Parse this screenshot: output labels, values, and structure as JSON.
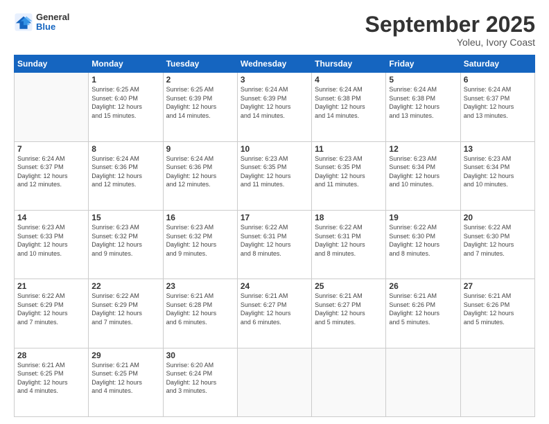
{
  "header": {
    "logo_general": "General",
    "logo_blue": "Blue",
    "month_title": "September 2025",
    "location": "Yoleu, Ivory Coast"
  },
  "days_of_week": [
    "Sunday",
    "Monday",
    "Tuesday",
    "Wednesday",
    "Thursday",
    "Friday",
    "Saturday"
  ],
  "weeks": [
    [
      {
        "day": "",
        "info": ""
      },
      {
        "day": "1",
        "info": "Sunrise: 6:25 AM\nSunset: 6:40 PM\nDaylight: 12 hours\nand 15 minutes."
      },
      {
        "day": "2",
        "info": "Sunrise: 6:25 AM\nSunset: 6:39 PM\nDaylight: 12 hours\nand 14 minutes."
      },
      {
        "day": "3",
        "info": "Sunrise: 6:24 AM\nSunset: 6:39 PM\nDaylight: 12 hours\nand 14 minutes."
      },
      {
        "day": "4",
        "info": "Sunrise: 6:24 AM\nSunset: 6:38 PM\nDaylight: 12 hours\nand 14 minutes."
      },
      {
        "day": "5",
        "info": "Sunrise: 6:24 AM\nSunset: 6:38 PM\nDaylight: 12 hours\nand 13 minutes."
      },
      {
        "day": "6",
        "info": "Sunrise: 6:24 AM\nSunset: 6:37 PM\nDaylight: 12 hours\nand 13 minutes."
      }
    ],
    [
      {
        "day": "7",
        "info": "Sunrise: 6:24 AM\nSunset: 6:37 PM\nDaylight: 12 hours\nand 12 minutes."
      },
      {
        "day": "8",
        "info": "Sunrise: 6:24 AM\nSunset: 6:36 PM\nDaylight: 12 hours\nand 12 minutes."
      },
      {
        "day": "9",
        "info": "Sunrise: 6:24 AM\nSunset: 6:36 PM\nDaylight: 12 hours\nand 12 minutes."
      },
      {
        "day": "10",
        "info": "Sunrise: 6:23 AM\nSunset: 6:35 PM\nDaylight: 12 hours\nand 11 minutes."
      },
      {
        "day": "11",
        "info": "Sunrise: 6:23 AM\nSunset: 6:35 PM\nDaylight: 12 hours\nand 11 minutes."
      },
      {
        "day": "12",
        "info": "Sunrise: 6:23 AM\nSunset: 6:34 PM\nDaylight: 12 hours\nand 10 minutes."
      },
      {
        "day": "13",
        "info": "Sunrise: 6:23 AM\nSunset: 6:34 PM\nDaylight: 12 hours\nand 10 minutes."
      }
    ],
    [
      {
        "day": "14",
        "info": "Sunrise: 6:23 AM\nSunset: 6:33 PM\nDaylight: 12 hours\nand 10 minutes."
      },
      {
        "day": "15",
        "info": "Sunrise: 6:23 AM\nSunset: 6:32 PM\nDaylight: 12 hours\nand 9 minutes."
      },
      {
        "day": "16",
        "info": "Sunrise: 6:23 AM\nSunset: 6:32 PM\nDaylight: 12 hours\nand 9 minutes."
      },
      {
        "day": "17",
        "info": "Sunrise: 6:22 AM\nSunset: 6:31 PM\nDaylight: 12 hours\nand 8 minutes."
      },
      {
        "day": "18",
        "info": "Sunrise: 6:22 AM\nSunset: 6:31 PM\nDaylight: 12 hours\nand 8 minutes."
      },
      {
        "day": "19",
        "info": "Sunrise: 6:22 AM\nSunset: 6:30 PM\nDaylight: 12 hours\nand 8 minutes."
      },
      {
        "day": "20",
        "info": "Sunrise: 6:22 AM\nSunset: 6:30 PM\nDaylight: 12 hours\nand 7 minutes."
      }
    ],
    [
      {
        "day": "21",
        "info": "Sunrise: 6:22 AM\nSunset: 6:29 PM\nDaylight: 12 hours\nand 7 minutes."
      },
      {
        "day": "22",
        "info": "Sunrise: 6:22 AM\nSunset: 6:29 PM\nDaylight: 12 hours\nand 7 minutes."
      },
      {
        "day": "23",
        "info": "Sunrise: 6:21 AM\nSunset: 6:28 PM\nDaylight: 12 hours\nand 6 minutes."
      },
      {
        "day": "24",
        "info": "Sunrise: 6:21 AM\nSunset: 6:27 PM\nDaylight: 12 hours\nand 6 minutes."
      },
      {
        "day": "25",
        "info": "Sunrise: 6:21 AM\nSunset: 6:27 PM\nDaylight: 12 hours\nand 5 minutes."
      },
      {
        "day": "26",
        "info": "Sunrise: 6:21 AM\nSunset: 6:26 PM\nDaylight: 12 hours\nand 5 minutes."
      },
      {
        "day": "27",
        "info": "Sunrise: 6:21 AM\nSunset: 6:26 PM\nDaylight: 12 hours\nand 5 minutes."
      }
    ],
    [
      {
        "day": "28",
        "info": "Sunrise: 6:21 AM\nSunset: 6:25 PM\nDaylight: 12 hours\nand 4 minutes."
      },
      {
        "day": "29",
        "info": "Sunrise: 6:21 AM\nSunset: 6:25 PM\nDaylight: 12 hours\nand 4 minutes."
      },
      {
        "day": "30",
        "info": "Sunrise: 6:20 AM\nSunset: 6:24 PM\nDaylight: 12 hours\nand 3 minutes."
      },
      {
        "day": "",
        "info": ""
      },
      {
        "day": "",
        "info": ""
      },
      {
        "day": "",
        "info": ""
      },
      {
        "day": "",
        "info": ""
      }
    ]
  ]
}
